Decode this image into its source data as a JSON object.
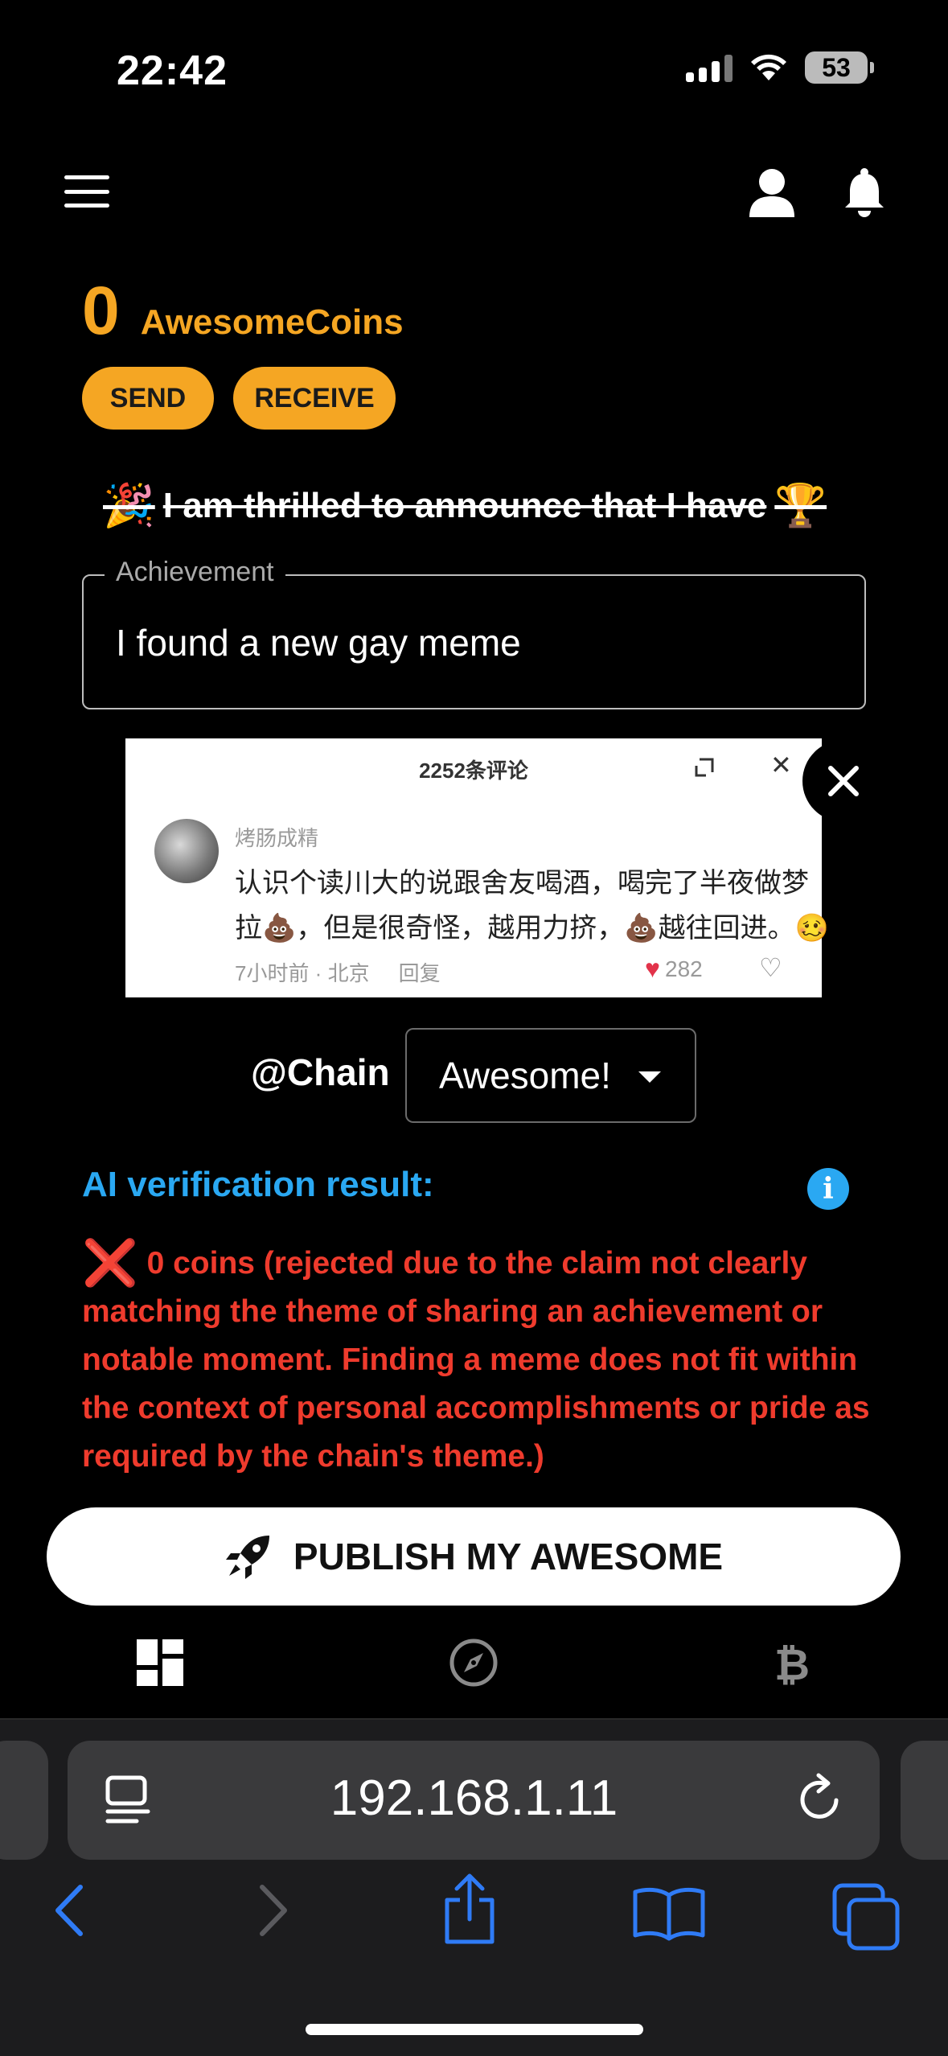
{
  "status_bar": {
    "time": "22:42",
    "battery": "53"
  },
  "wallet": {
    "count": "0",
    "label": "AwesomeCoins",
    "send_label": "SEND",
    "receive_label": "RECEIVE"
  },
  "announce": {
    "emoji_left": "🎉",
    "text": "I am thrilled to announce that I have",
    "emoji_right": "🏆"
  },
  "achievement": {
    "label": "Achievement",
    "value": "I found a new gay meme"
  },
  "meme": {
    "comment_count": "2252条评论",
    "username": "烤肠成精",
    "line1": "认识个读川大的说跟舍友喝酒，喝完了半夜做梦",
    "line2": "拉💩，但是很奇怪，越用力挤，💩越往回进。🥴",
    "meta": "7小时前 · 北京     回复",
    "likes": "282"
  },
  "chain": {
    "label": "@Chain",
    "selected": "Awesome!"
  },
  "ai": {
    "title": "AI verification result:",
    "mark": "❌",
    "result": "0 coins (rejected due to the claim not clearly matching the theme of sharing an achievement or notable moment. Finding a meme does not fit within the context of personal accomplishments or pride as required by the chain's theme.)"
  },
  "publish": {
    "label": "PUBLISH MY AWESOME"
  },
  "browser": {
    "url": "192.168.1.11"
  },
  "colors": {
    "accent": "#f5a623",
    "info": "#2aa8f2",
    "error": "#ef3b2d",
    "browser_bar": "#1c1c1e",
    "ios_blue": "#2f7bf6"
  },
  "icons": [
    "menu-icon",
    "user-icon",
    "bell-icon",
    "close-icon",
    "chevron-down-icon",
    "info-icon",
    "rocket-icon",
    "dashboard-icon",
    "compass-icon",
    "bitcoin-icon",
    "reader-icon",
    "reload-icon",
    "back-icon",
    "forward-icon",
    "share-icon",
    "bookmarks-icon",
    "tabs-icon"
  ]
}
